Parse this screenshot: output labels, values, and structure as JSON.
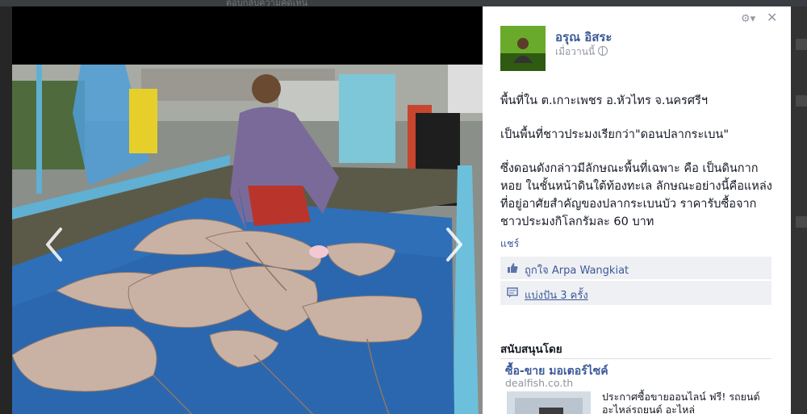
{
  "background": {
    "hint_text": "ตอบกลับความคิดเห็น"
  },
  "post": {
    "author": "อรุณ อิสระ",
    "time": "เมื่อวานนี้",
    "paragraphs": [
      "พื้นที่ใน ต.เกาะเพชร อ.หัวไทร จ.นครศรีฯ",
      "เป็นพื้นที่ชาวประมงเรียกว่า\"ดอนปลากระเบน\"",
      "ซึ่งดอนดังกล่าวมีลักษณะพื้นที่เฉพาะ คือ เป็นดินกากหอย ในชั้นหน้าดินใต้ท้องทะเล ลักษณะอย่างนี้คือแหล่งที่อยู่อาศัยสำคัญของปลากระเบนบัว ราคารับซื้อจากชาวประมงกิโลกรัมละ 60 บาท"
    ],
    "share_link": "แชร์",
    "likes_prefix": "ถูกใจ",
    "likes_name": "Arpa Wangkiat",
    "shares_text": "แบ่งปัน 3 ครั้ง"
  },
  "sponsored": {
    "heading": "สนับสนุนโดย",
    "ad_title": "ซื้อ-ขาย มอเตอร์ไซค์",
    "ad_domain": "dealfish.co.th",
    "ad_text": "ประกาศซื้อขายออนไลน์ ฟรี! รถยนต์ อะไหล่รถยนต์ อะไหล่"
  },
  "icons": {
    "prev": "chevron-left-icon",
    "next": "chevron-right-icon",
    "close": "close-icon",
    "gear": "gear-icon",
    "like": "thumbs-up-icon",
    "share": "share-icon",
    "globe": "globe-icon"
  },
  "colors": {
    "link": "#3b5998",
    "panel_bg": "#ffffff",
    "box_bg": "#eff0f4",
    "tarp": "#2f6fb8"
  }
}
